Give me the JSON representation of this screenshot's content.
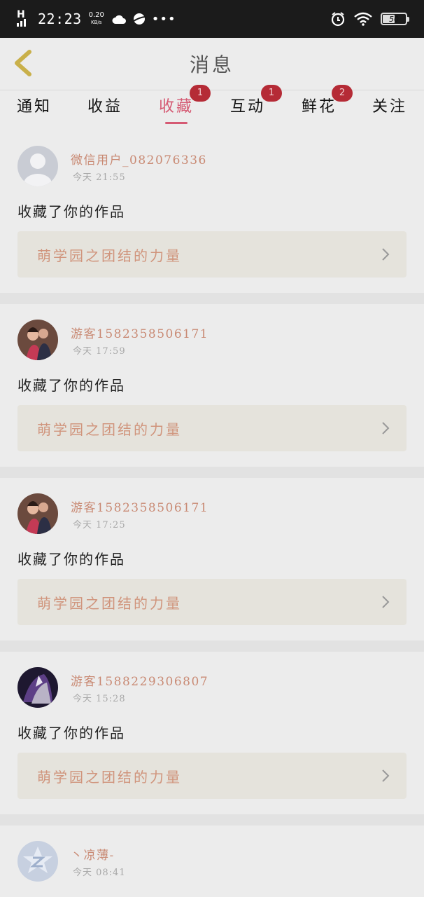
{
  "status_bar": {
    "network": "H",
    "time": "22:23",
    "speed_value": "0.20",
    "speed_unit": "KB/s",
    "more": "•••",
    "battery": "50"
  },
  "header": {
    "title": "消息",
    "back_icon": "chevron-left-icon"
  },
  "tabs": [
    {
      "label": "通知",
      "badge": ""
    },
    {
      "label": "收益",
      "badge": ""
    },
    {
      "label": "收藏",
      "badge": "1",
      "active": true
    },
    {
      "label": "互动",
      "badge": "1"
    },
    {
      "label": "鲜花",
      "badge": "2"
    },
    {
      "label": "关注",
      "badge": ""
    }
  ],
  "messages": [
    {
      "user": "微信用户_082076336",
      "time": "今天 21:55",
      "action": "收藏了你的作品",
      "work": "萌学园之团结的力量"
    },
    {
      "user": "游客1582358506171",
      "time": "今天 17:59",
      "action": "收藏了你的作品",
      "work": "萌学园之团结的力量"
    },
    {
      "user": "游客1582358506171",
      "time": "今天 17:25",
      "action": "收藏了你的作品",
      "work": "萌学园之团结的力量"
    },
    {
      "user": "游客1588229306807",
      "time": "今天 15:28",
      "action": "收藏了你的作品",
      "work": "萌学园之团结的力量"
    },
    {
      "user": "丶凉薄-",
      "time": "今天 08:41"
    }
  ],
  "colors": {
    "accent": "#d55a73",
    "badge": "#b52b36",
    "username": "#c98a74",
    "work_title": "#d0947c"
  }
}
